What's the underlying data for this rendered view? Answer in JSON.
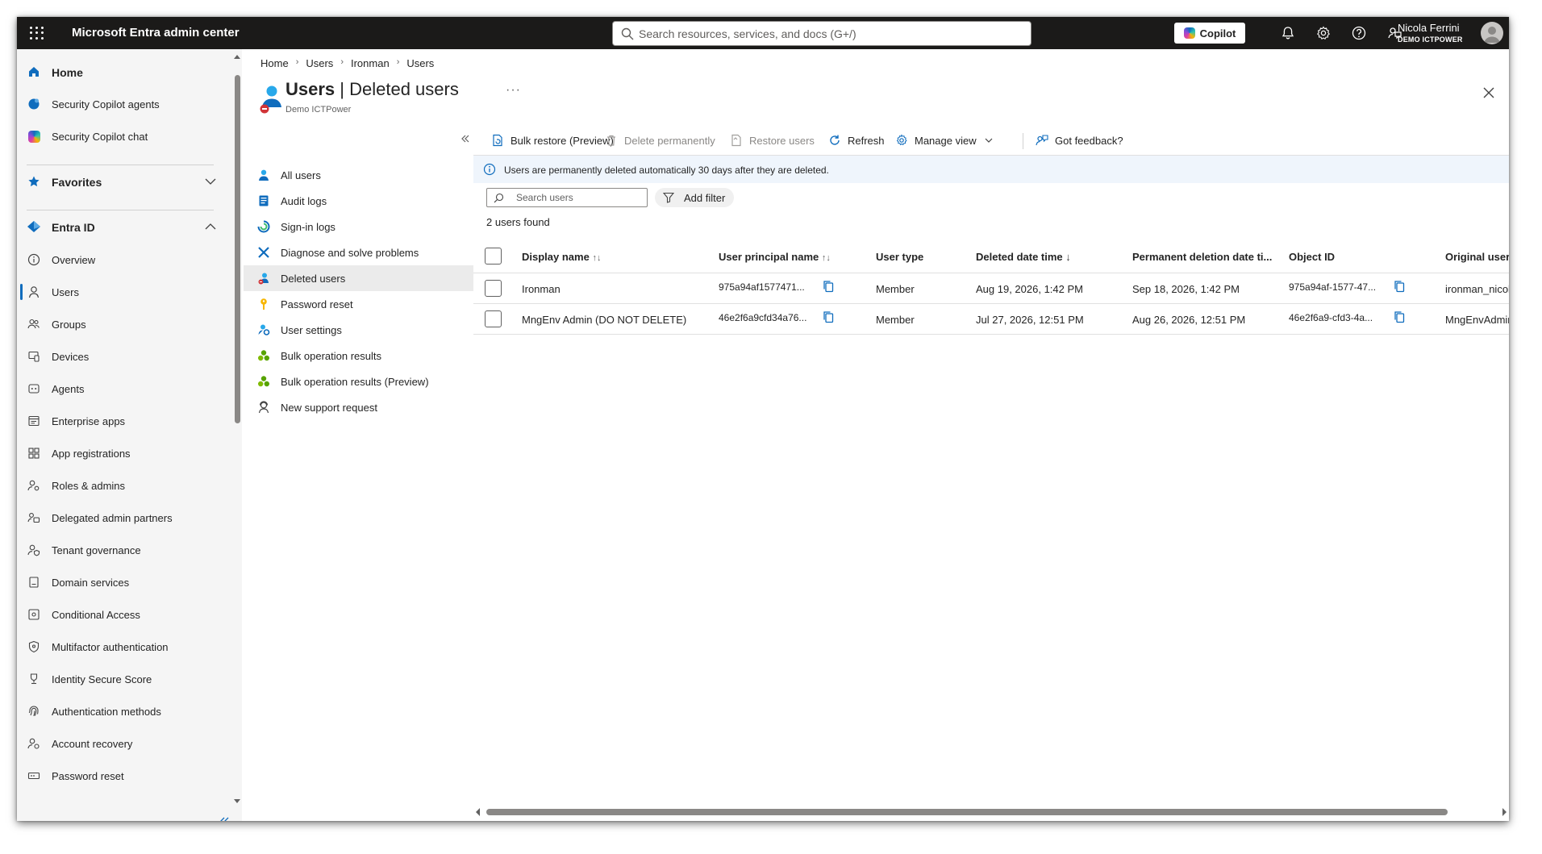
{
  "app": {
    "title": "Microsoft Entra admin center",
    "search_placeholder": "Search resources, services, and docs (G+/)",
    "copilot_label": "Copilot",
    "user_name": "Nicola Ferrini",
    "user_tenant": "DEMO ICTPOWER"
  },
  "leftnav": {
    "home": "Home",
    "security_copilot_agents": "Security Copilot agents",
    "security_copilot_chat": "Security Copilot chat",
    "favorites": "Favorites",
    "entra_id": "Entra ID",
    "items": [
      "Overview",
      "Users",
      "Groups",
      "Devices",
      "Agents",
      "Enterprise apps",
      "App registrations",
      "Roles & admins",
      "Delegated admin partners",
      "Tenant governance",
      "Domain services",
      "Conditional Access",
      "Multifactor authentication",
      "Identity Secure Score",
      "Authentication methods",
      "Account recovery",
      "Password reset"
    ]
  },
  "breadcrumb": [
    "Home",
    "Users",
    "Ironman",
    "Users"
  ],
  "page": {
    "title_main": "Users",
    "title_rest": " | Deleted users",
    "subtitle": "Demo ICTPower",
    "more": "···"
  },
  "subnav": [
    "All users",
    "Audit logs",
    "Sign-in logs",
    "Diagnose and solve problems",
    "Deleted users",
    "Password reset",
    "User settings",
    "Bulk operation results",
    "Bulk operation results (Preview)",
    "New support request"
  ],
  "toolbar": {
    "bulk_restore": "Bulk restore (Preview)",
    "delete_permanently": "Delete permanently",
    "restore_users": "Restore users",
    "refresh": "Refresh",
    "manage_view": "Manage view",
    "feedback": "Got feedback?"
  },
  "info": "Users are permanently deleted automatically 30 days after they are deleted.",
  "search_users_placeholder": "Search users",
  "add_filter": "Add filter",
  "count_text": "2 users found",
  "table": {
    "headers": {
      "display_name": "Display name",
      "upn": "User principal name",
      "user_type": "User type",
      "deleted": "Deleted date time",
      "permanent": "Permanent deletion date ti...",
      "object_id": "Object ID",
      "original_upn": "Original user prin"
    },
    "sort_both": "↑↓",
    "sort_down": "↓",
    "rows": [
      {
        "display_name": "Ironman",
        "upn": "975a94af1577471...",
        "user_type": "Member",
        "deleted": "Aug 19, 2026, 1:42 PM",
        "permanent": "Sep 18, 2026, 1:42 PM",
        "object_id": "975a94af-1577-47...",
        "original_upn": "ironman_nicolafe"
      },
      {
        "display_name": "MngEnv Admin (DO NOT DELETE)",
        "upn": "46e2f6a9cfd34a76...",
        "user_type": "Member",
        "deleted": "Jul 27, 2026, 12:51 PM",
        "permanent": "Aug 26, 2026, 12:51 PM",
        "object_id": "46e2f6a9-cfd3-4a...",
        "original_upn": "MngEnvAdmin@r"
      }
    ]
  },
  "colors": {
    "topbar": "#1b1a19",
    "accent": "#0f6cbd",
    "nav_bg": "#f5f5f5",
    "info_bg": "#eff5fc"
  }
}
